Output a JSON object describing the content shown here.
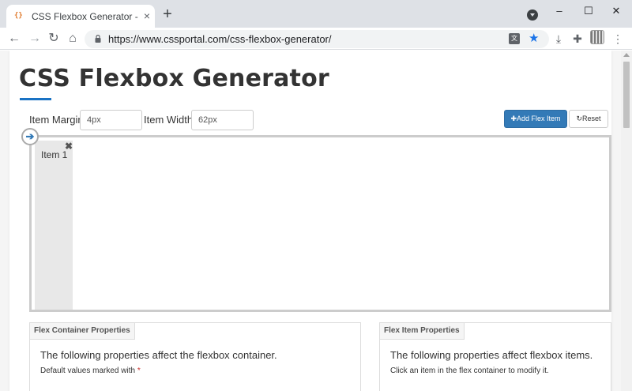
{
  "browser": {
    "tab_title": "CSS Flexbox Generator - CSS Po",
    "favicon": "{}",
    "tab_close": "×",
    "new_tab": "+",
    "url": "https://www.cssportal.com/css-flexbox-generator/",
    "window_controls": {
      "minimize": "–",
      "maximize": "☐",
      "close": "✕"
    },
    "nav": {
      "back": "←",
      "forward": "→",
      "reload": "↻",
      "home": "⌂"
    },
    "toolbar_icons": {
      "download": "⤓",
      "extensions": "✚",
      "menu": "⋮"
    },
    "translate_glyph": "文",
    "star_glyph": "★"
  },
  "page": {
    "title": "CSS Flexbox Generator",
    "controls": {
      "item_margin_label": "Item Margin",
      "item_margin_value": "4px",
      "item_width_label": "Item Width",
      "item_width_value": "62px",
      "add_button": "✚Add Flex Item",
      "reset_button": "↻Reset"
    },
    "direction_glyph": "➔",
    "flex_items": [
      {
        "label": "Item 1",
        "close": "✖"
      }
    ],
    "panels": {
      "container": {
        "tag": "Flex Container Properties",
        "text": "The following properties affect the flexbox container.",
        "sub": "Default values marked with",
        "asterisk": "*"
      },
      "item": {
        "tag": "Flex Item Properties",
        "text": "The following properties affect flexbox items.",
        "sub": "Click an item in the flex container to modify it."
      }
    }
  },
  "colors": {
    "accent": "#337ab7",
    "title_rule": "#1a73c4",
    "tab_strip": "#dee1e6"
  }
}
